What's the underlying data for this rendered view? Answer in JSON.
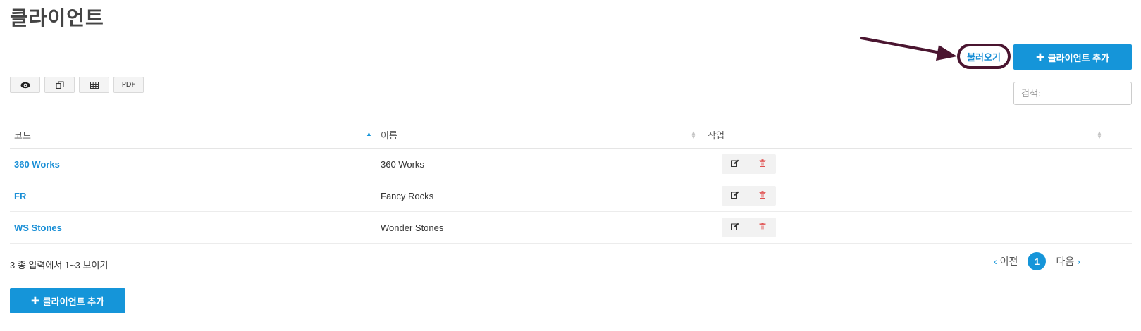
{
  "page": {
    "title": "클라이언트"
  },
  "header_actions": {
    "import_label": "불러오기",
    "add_client_label": "클라이언트 추가"
  },
  "search": {
    "placeholder": "검색:"
  },
  "toolbar": {
    "buttons": [
      {
        "icon": "eye-icon"
      },
      {
        "icon": "copy-icon"
      },
      {
        "icon": "table-icon"
      },
      {
        "label": "PDF"
      }
    ]
  },
  "table": {
    "columns": [
      {
        "label": "코드",
        "sort": "asc"
      },
      {
        "label": "이름",
        "sort": "none"
      },
      {
        "label": "작업",
        "sort": "none"
      }
    ],
    "rows": [
      {
        "code": "360 Works",
        "name": "360 Works"
      },
      {
        "code": "FR",
        "name": "Fancy Rocks"
      },
      {
        "code": "WS Stones",
        "name": "Wonder Stones"
      }
    ],
    "row_action_icons": [
      "edit-icon",
      "trash-icon"
    ]
  },
  "footer": {
    "info": "3 종 입력에서 1~3 보이기",
    "add_client_label": "클라이언트 추가"
  },
  "pagination": {
    "prev_label": "이전",
    "next_label": "다음",
    "current_page": "1"
  },
  "colors": {
    "accent": "#1595d9",
    "link": "#1a8fd6",
    "highlight_ring": "#4a1530",
    "delete": "#e05050"
  }
}
